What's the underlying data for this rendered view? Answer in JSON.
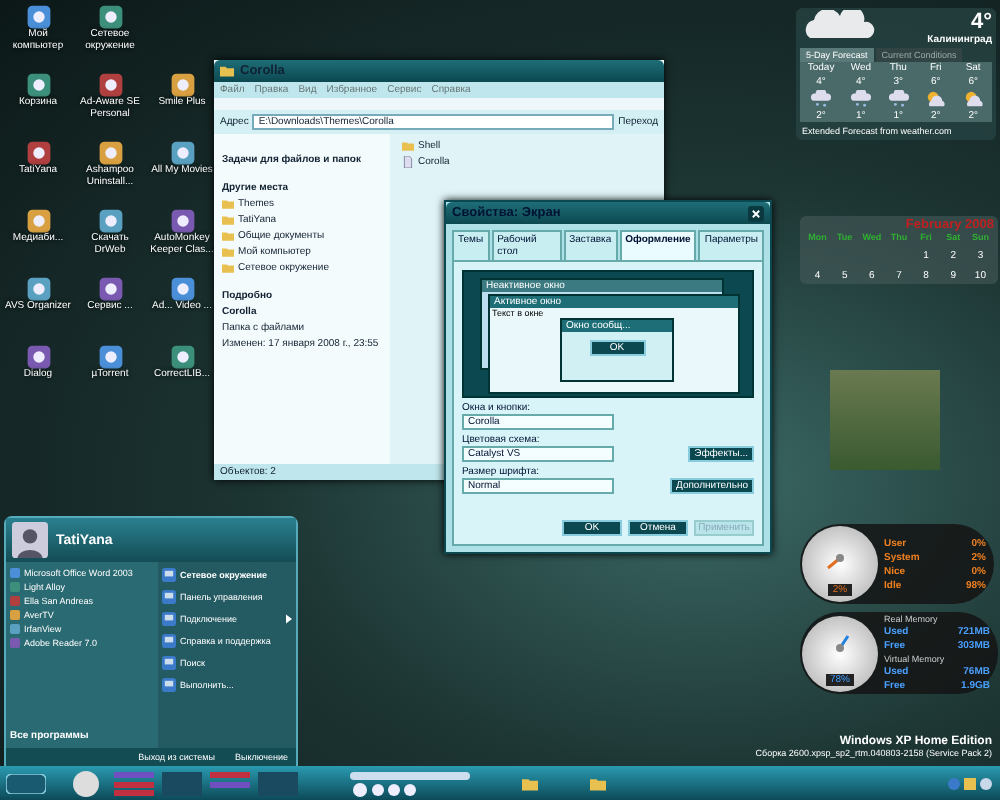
{
  "desktop_icons": [
    [
      {
        "label": "Мой компьютер"
      },
      {
        "label": "Сетевое окружение"
      }
    ],
    [
      {
        "label": "Корзина"
      },
      {
        "label": "Ad-Aware SE Personal"
      },
      {
        "label": "Smile Plus"
      }
    ],
    [
      {
        "label": "TatiYana"
      },
      {
        "label": "Ashampoo Uninstall..."
      },
      {
        "label": "All My Movies"
      }
    ],
    [
      {
        "label": "Медиаби..."
      },
      {
        "label": "Скачать DrWeb"
      },
      {
        "label": "AutoMonkey Keeper Clas..."
      }
    ],
    [
      {
        "label": "AVS Organizer"
      },
      {
        "label": "Сервис ..."
      },
      {
        "label": "Ad... Video ..."
      }
    ],
    [
      {
        "label": "Dialog"
      },
      {
        "label": "µTorrent"
      },
      {
        "label": "CorrectLIB..."
      }
    ]
  ],
  "explorer": {
    "title": "Corolla",
    "menu": [
      "Файл",
      "Правка",
      "Вид",
      "Избранное",
      "Сервис",
      "Справка"
    ],
    "address_label": "Адрес",
    "address": "E:\\Downloads\\Themes\\Corolla",
    "go": "Переход",
    "tasks_title": "Задачи для файлов и папок",
    "other_places_title": "Другие места",
    "places": [
      "Themes",
      "TatiYana",
      "Общие документы",
      "Мой компьютер",
      "Сетевое окружение"
    ],
    "details_title": "Подробно",
    "details": [
      "Corolla",
      "Папка с файлами",
      "Изменен: 17 января 2008 г., 23:55"
    ],
    "files": [
      {
        "name": "Shell",
        "kind": "folder"
      },
      {
        "name": "Corolla",
        "kind": "file"
      }
    ],
    "status": "Объектов: 2"
  },
  "display_properties": {
    "title": "Свойства: Экран",
    "tabs": [
      {
        "label": "Темы",
        "selected": false
      },
      {
        "label": "Рабочий стол",
        "selected": false
      },
      {
        "label": "Заставка",
        "selected": false
      },
      {
        "label": "Оформление",
        "selected": true
      },
      {
        "label": "Параметры",
        "selected": false
      }
    ],
    "preview": {
      "inactive_title": "Неактивное окно",
      "active_title": "Активное окно",
      "window_text": "Текст в окне",
      "message_title": "Окно сообщ...",
      "ok": "OK"
    },
    "fields": [
      {
        "label": "Окна и кнопки:",
        "value": "Corolla"
      },
      {
        "label": "Цветовая схема:",
        "value": "Catalyst VS"
      },
      {
        "label": "Размер шрифта:",
        "value": "Normal"
      }
    ],
    "effects_button": "Эффекты...",
    "advanced_button": "Дополнительно",
    "buttons": [
      {
        "label": "OK",
        "disabled": false
      },
      {
        "label": "Отмена",
        "disabled": false
      },
      {
        "label": "Применить",
        "disabled": true
      }
    ]
  },
  "start_menu": {
    "user": "TatiYana",
    "programs": [
      "Microsoft Office Word 2003",
      "Light Alloy",
      "Ella San Andreas",
      "AverTV",
      "IrfanView",
      "Adobe Reader 7.0"
    ],
    "all_programs": "Все программы",
    "places": [
      {
        "label": "Сетевое окружение",
        "bold": true,
        "submenu": false
      },
      {
        "label": "Панель управления",
        "bold": false,
        "submenu": false
      },
      {
        "label": "Подключение",
        "bold": false,
        "submenu": true
      },
      {
        "label": "Справка и поддержка",
        "bold": false,
        "submenu": false
      },
      {
        "label": "Поиск",
        "bold": false,
        "submenu": false
      },
      {
        "label": "Выполнить...",
        "bold": false,
        "submenu": false
      }
    ],
    "logoff": "Выход из системы",
    "shutdown": "Выключение"
  },
  "weather": {
    "temp": "4°",
    "city": "Калининград",
    "tabs": [
      {
        "label": "5-Day Forecast",
        "selected": true
      },
      {
        "label": "Current Conditions",
        "selected": false
      }
    ],
    "days": [
      {
        "day": "Today",
        "high": "4°",
        "low": "2°",
        "kind": "snow"
      },
      {
        "day": "Wed",
        "high": "4°",
        "low": "1°",
        "kind": "snow"
      },
      {
        "day": "Thu",
        "high": "3°",
        "low": "1°",
        "kind": "snow"
      },
      {
        "day": "Fri",
        "high": "6°",
        "low": "2°",
        "kind": "sun"
      },
      {
        "day": "Sat",
        "high": "6°",
        "low": "2°",
        "kind": "sun"
      }
    ],
    "footer": "Extended Forecast from weather.com"
  },
  "calendar": {
    "month": "February 2008",
    "weekdays": [
      "Mon",
      "Tue",
      "Wed",
      "Thu",
      "Fri",
      "Sat",
      "Sun"
    ],
    "weeks": [
      {
        "days": [
          "1",
          "2",
          "3"
        ],
        "partial": true
      },
      {
        "days": [
          "4",
          "5",
          "6",
          "7",
          "8",
          "9",
          "10"
        ]
      }
    ]
  },
  "cpu_meter": {
    "reading": "2%",
    "stats": [
      {
        "label": "User",
        "value": "0%"
      },
      {
        "label": "System",
        "value": "2%"
      },
      {
        "label": "Nice",
        "value": "0%"
      },
      {
        "label": "Idle",
        "value": "98%"
      }
    ]
  },
  "memory_meter": {
    "reading": "78%",
    "groups": [
      {
        "title": "Real Memory",
        "rows": [
          {
            "label": "Used",
            "value": "721MB"
          },
          {
            "label": "Free",
            "value": "303MB"
          }
        ]
      },
      {
        "title": "Virtual Memory",
        "rows": [
          {
            "label": "Used",
            "value": "76MB"
          },
          {
            "label": "Free",
            "value": "1.9GB"
          }
        ]
      }
    ]
  },
  "os_info": {
    "edition": "Windows XP Home Edition",
    "build": "Сборка 2600.xpsp_sp2_rtm.040803-2158 (Service Pack 2)"
  }
}
